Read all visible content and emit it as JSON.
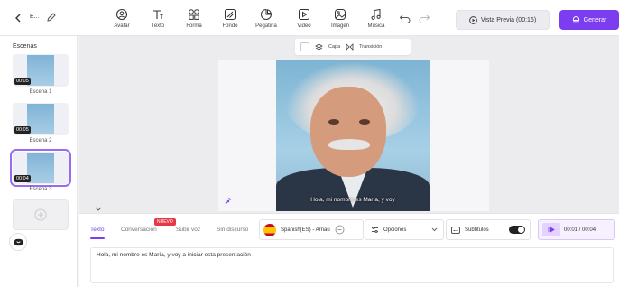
{
  "header": {
    "project_name": "E...",
    "tools": [
      {
        "id": "avatar",
        "label": "Avatar"
      },
      {
        "id": "text",
        "label": "Texto"
      },
      {
        "id": "shape",
        "label": "Forma"
      },
      {
        "id": "background",
        "label": "Fondo"
      },
      {
        "id": "sticker",
        "label": "Pegatina"
      },
      {
        "id": "video",
        "label": "Video"
      },
      {
        "id": "image",
        "label": "Imagen"
      },
      {
        "id": "music",
        "label": "Música"
      }
    ],
    "preview_label": "Vista Previa (00:16)",
    "generate_label": "Generar"
  },
  "sidebar": {
    "title": "Escenas",
    "scenes": [
      {
        "label": "Escena 1",
        "duration": "00:05",
        "selected": false
      },
      {
        "label": "Escena 2",
        "duration": "00:05",
        "selected": false
      },
      {
        "label": "Escena 3",
        "duration": "00:04",
        "selected": true
      }
    ]
  },
  "canvas": {
    "toolbar": {
      "layer_label": "Capa",
      "transition_label": "Transición"
    },
    "caption": "Hola, mi nombre es María, y voy"
  },
  "script": {
    "tabs": [
      {
        "label": "Texto",
        "active": true
      },
      {
        "label": "Conversación",
        "active": false
      },
      {
        "label": "Subir voz",
        "active": false
      },
      {
        "label": "Sin discurso",
        "active": false
      }
    ],
    "new_badge": "NUEVO",
    "voice": "Spanish(ES) - Arnau",
    "options_label": "Opciones",
    "subtitles_label": "Subtítulos",
    "subtitles_on": true,
    "timer": "00:01 / 00:04",
    "text": "Hola, mi nombre es María, y voy a iniciar esta presentación"
  },
  "colors": {
    "accent": "#7c3cf0",
    "badge": "#e63946"
  }
}
